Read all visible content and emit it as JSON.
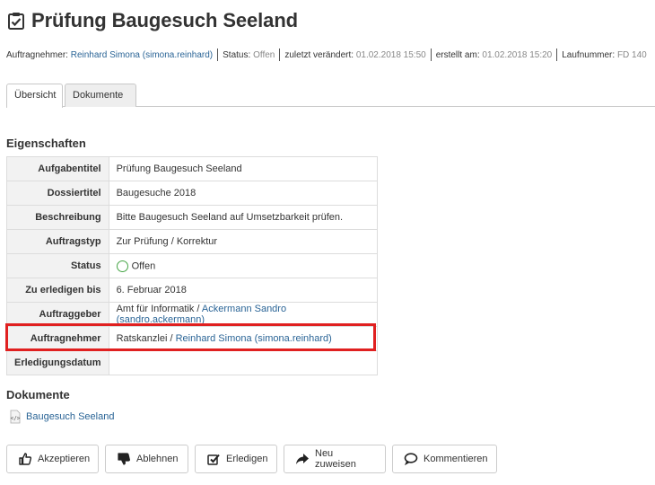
{
  "header": {
    "title": "Prüfung Baugesuch Seeland",
    "title_icon": "task-checkbox-icon"
  },
  "meta": {
    "assignee_label": "Auftragnehmer:",
    "assignee_value": "Reinhard Simona (simona.reinhard)",
    "status_label": "Status:",
    "status_value": "Offen",
    "modified_label": "zuletzt verändert:",
    "modified_value": "01.02.2018 15:50",
    "created_label": "erstellt am:",
    "created_value": "01.02.2018 15:20",
    "sequence_label": "Laufnummer:",
    "sequence_value": "FD 140"
  },
  "tabs": [
    {
      "label": "Übersicht",
      "active": true
    },
    {
      "label": "Dokumente",
      "active": false
    }
  ],
  "properties": {
    "section_title": "Eigenschaften",
    "rows": {
      "task_title": {
        "label": "Aufgabentitel",
        "value": "Prüfung Baugesuch Seeland"
      },
      "dossier_title": {
        "label": "Dossiertitel",
        "value": "Baugesuche 2018"
      },
      "description": {
        "label": "Beschreibung",
        "value": "Bitte Baugesuch Seeland auf Umsetzbarkeit prüfen."
      },
      "task_type": {
        "label": "Auftragstyp",
        "value": "Zur Prüfung / Korrektur"
      },
      "status": {
        "label": "Status",
        "value": "Offen",
        "color": "#46a546"
      },
      "deadline": {
        "label": "Zu erledigen bis",
        "value": "6. Februar 2018"
      },
      "issuer": {
        "label": "Auftraggeber",
        "org": "Amt für Informatik / ",
        "person": "Ackermann Sandro (sandro.ackermann)"
      },
      "responsible": {
        "label": "Auftragnehmer",
        "org": "Ratskanzlei / ",
        "person": "Reinhard Simona (simona.reinhard)"
      },
      "completion_date": {
        "label": "Erledigungsdatum",
        "value": ""
      }
    }
  },
  "documents": {
    "section_title": "Dokumente",
    "items": [
      {
        "label": "Baugesuch Seeland",
        "icon": "code-file-icon"
      }
    ]
  },
  "actions": [
    {
      "label": "Akzeptieren",
      "icon": "thumbs-up-icon"
    },
    {
      "label": "Ablehnen",
      "icon": "thumbs-down-icon"
    },
    {
      "label": "Erledigen",
      "icon": "check-square-icon"
    },
    {
      "label": "Neu zuweisen",
      "icon": "forward-arrow-icon"
    },
    {
      "label": "Kommentieren",
      "icon": "speech-bubble-icon"
    }
  ],
  "colors": {
    "link": "#2a6496",
    "highlight": "#e02020",
    "status_open": "#46a546"
  }
}
